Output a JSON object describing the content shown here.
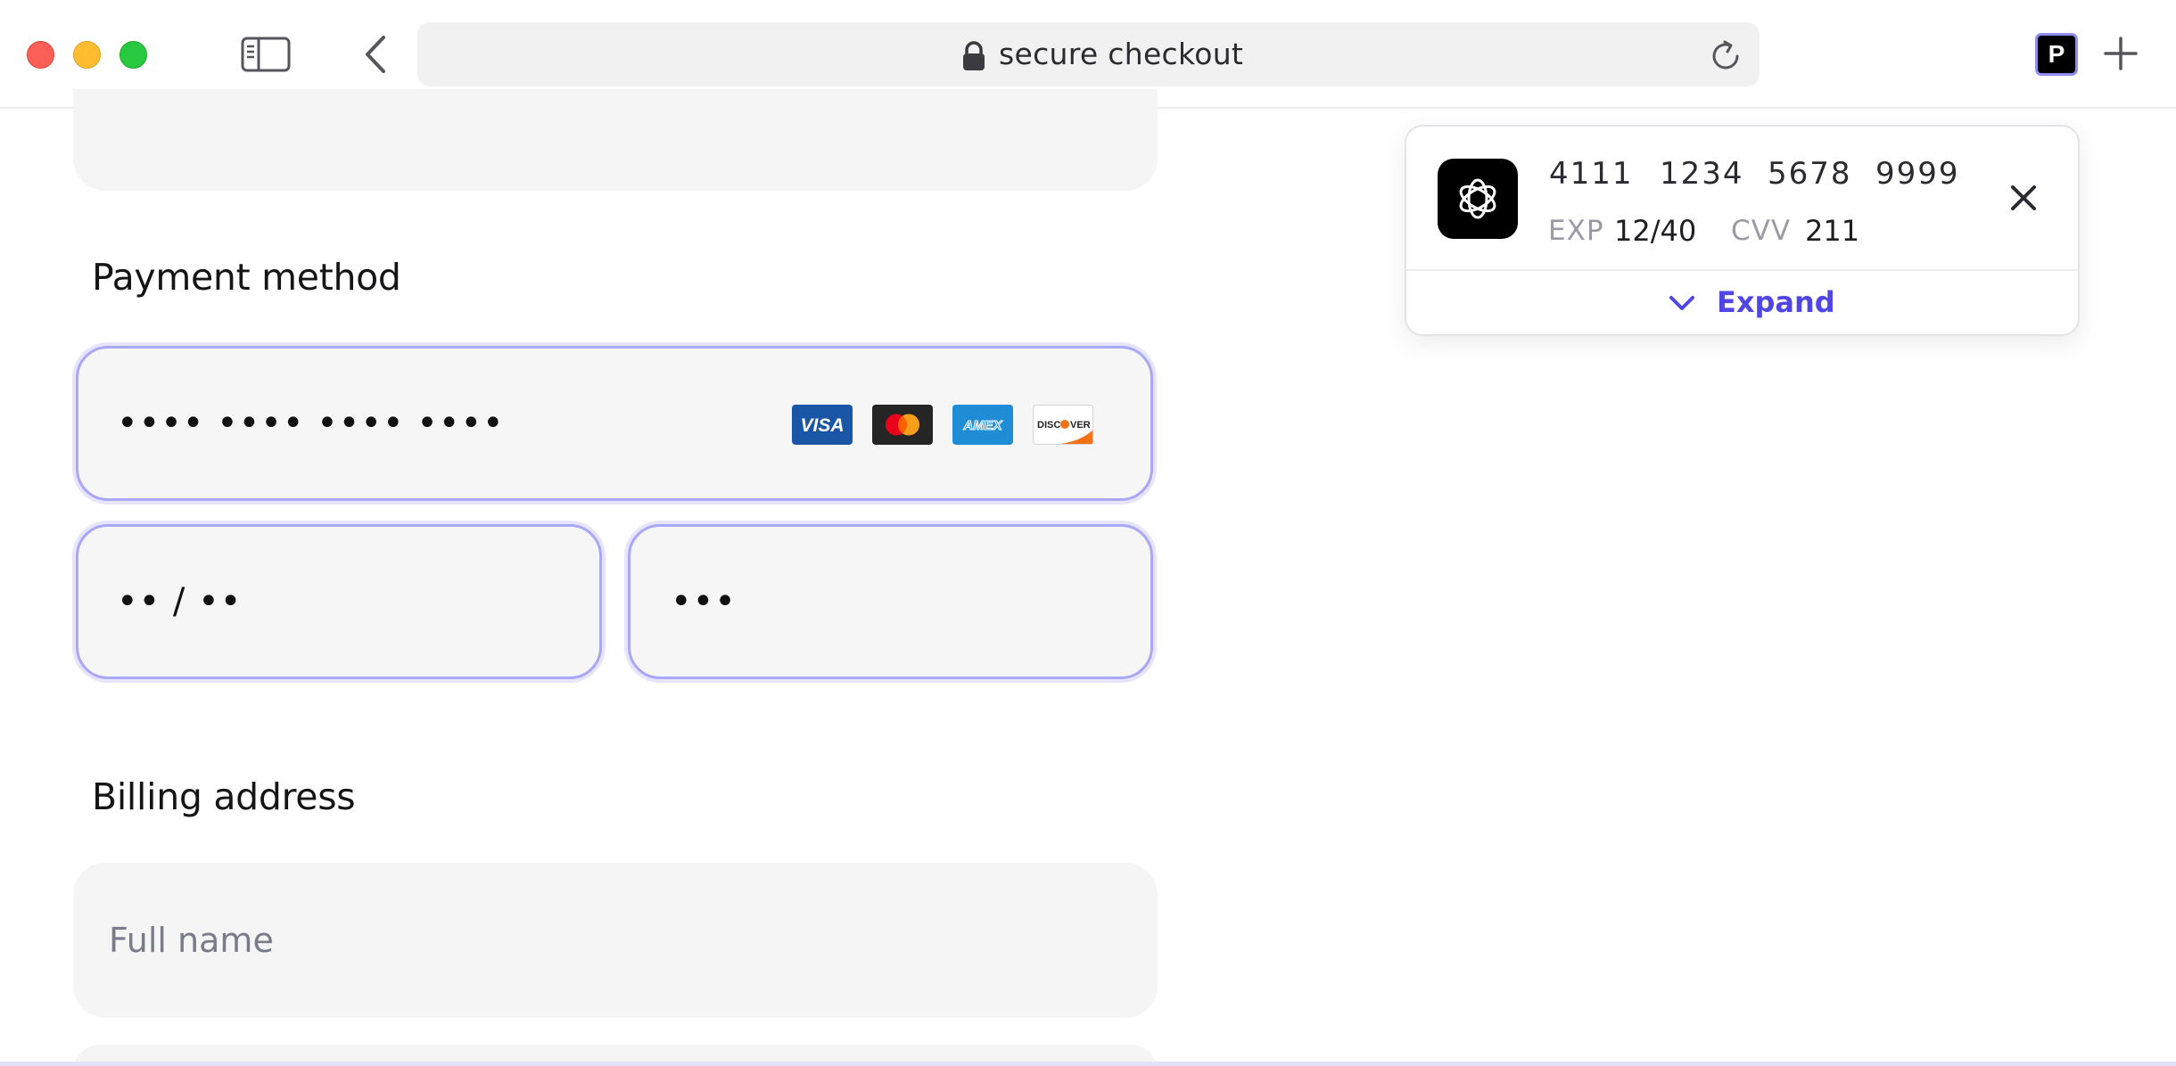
{
  "browser": {
    "address_text": "secure checkout",
    "extension_label": "P"
  },
  "payment": {
    "section_title": "Payment method",
    "card_number_masked": "•••• •••• •••• ••••",
    "expiry_masked": "•• / ••",
    "cvv_masked": "•••",
    "card_brands": [
      "VISA",
      "MasterCard",
      "AMEX",
      "DISCOVER"
    ]
  },
  "billing": {
    "section_title": "Billing address",
    "full_name_placeholder": "Full name"
  },
  "autofill_popup": {
    "card_number_groups": [
      "4111",
      "1234",
      "5678",
      "9999"
    ],
    "exp_label": "EXP",
    "exp_value": "12/40",
    "cvv_label": "CVV",
    "cvv_value": "211",
    "expand_label": "Expand"
  },
  "colors": {
    "accent": "#4f46e5",
    "focus_border": "#a9a7f6",
    "field_bg": "#f5f5f6"
  }
}
